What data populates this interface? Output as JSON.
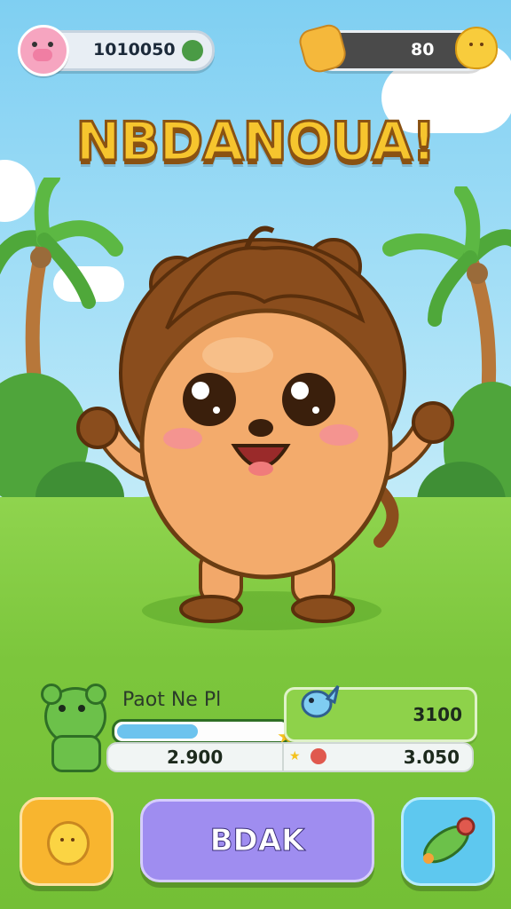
{
  "hud": {
    "coins": "1010050",
    "energy": "80"
  },
  "title": "NBDANOUA!",
  "pet_panel": {
    "name": "Paot Ne Pl",
    "xp_progress": 0.48,
    "stat_top": "3100",
    "stat_bottom_left": "2.900",
    "stat_bottom_right": "3.050"
  },
  "buttons": {
    "main_label": "BDAK",
    "left_icon": "lemon-face-icon",
    "right_icon": "cucumber-icon"
  },
  "colors": {
    "sky": "#7fcff2",
    "grass": "#7cc63c",
    "main_button": "#9f8df0",
    "title_fill": "#f6c52e"
  }
}
